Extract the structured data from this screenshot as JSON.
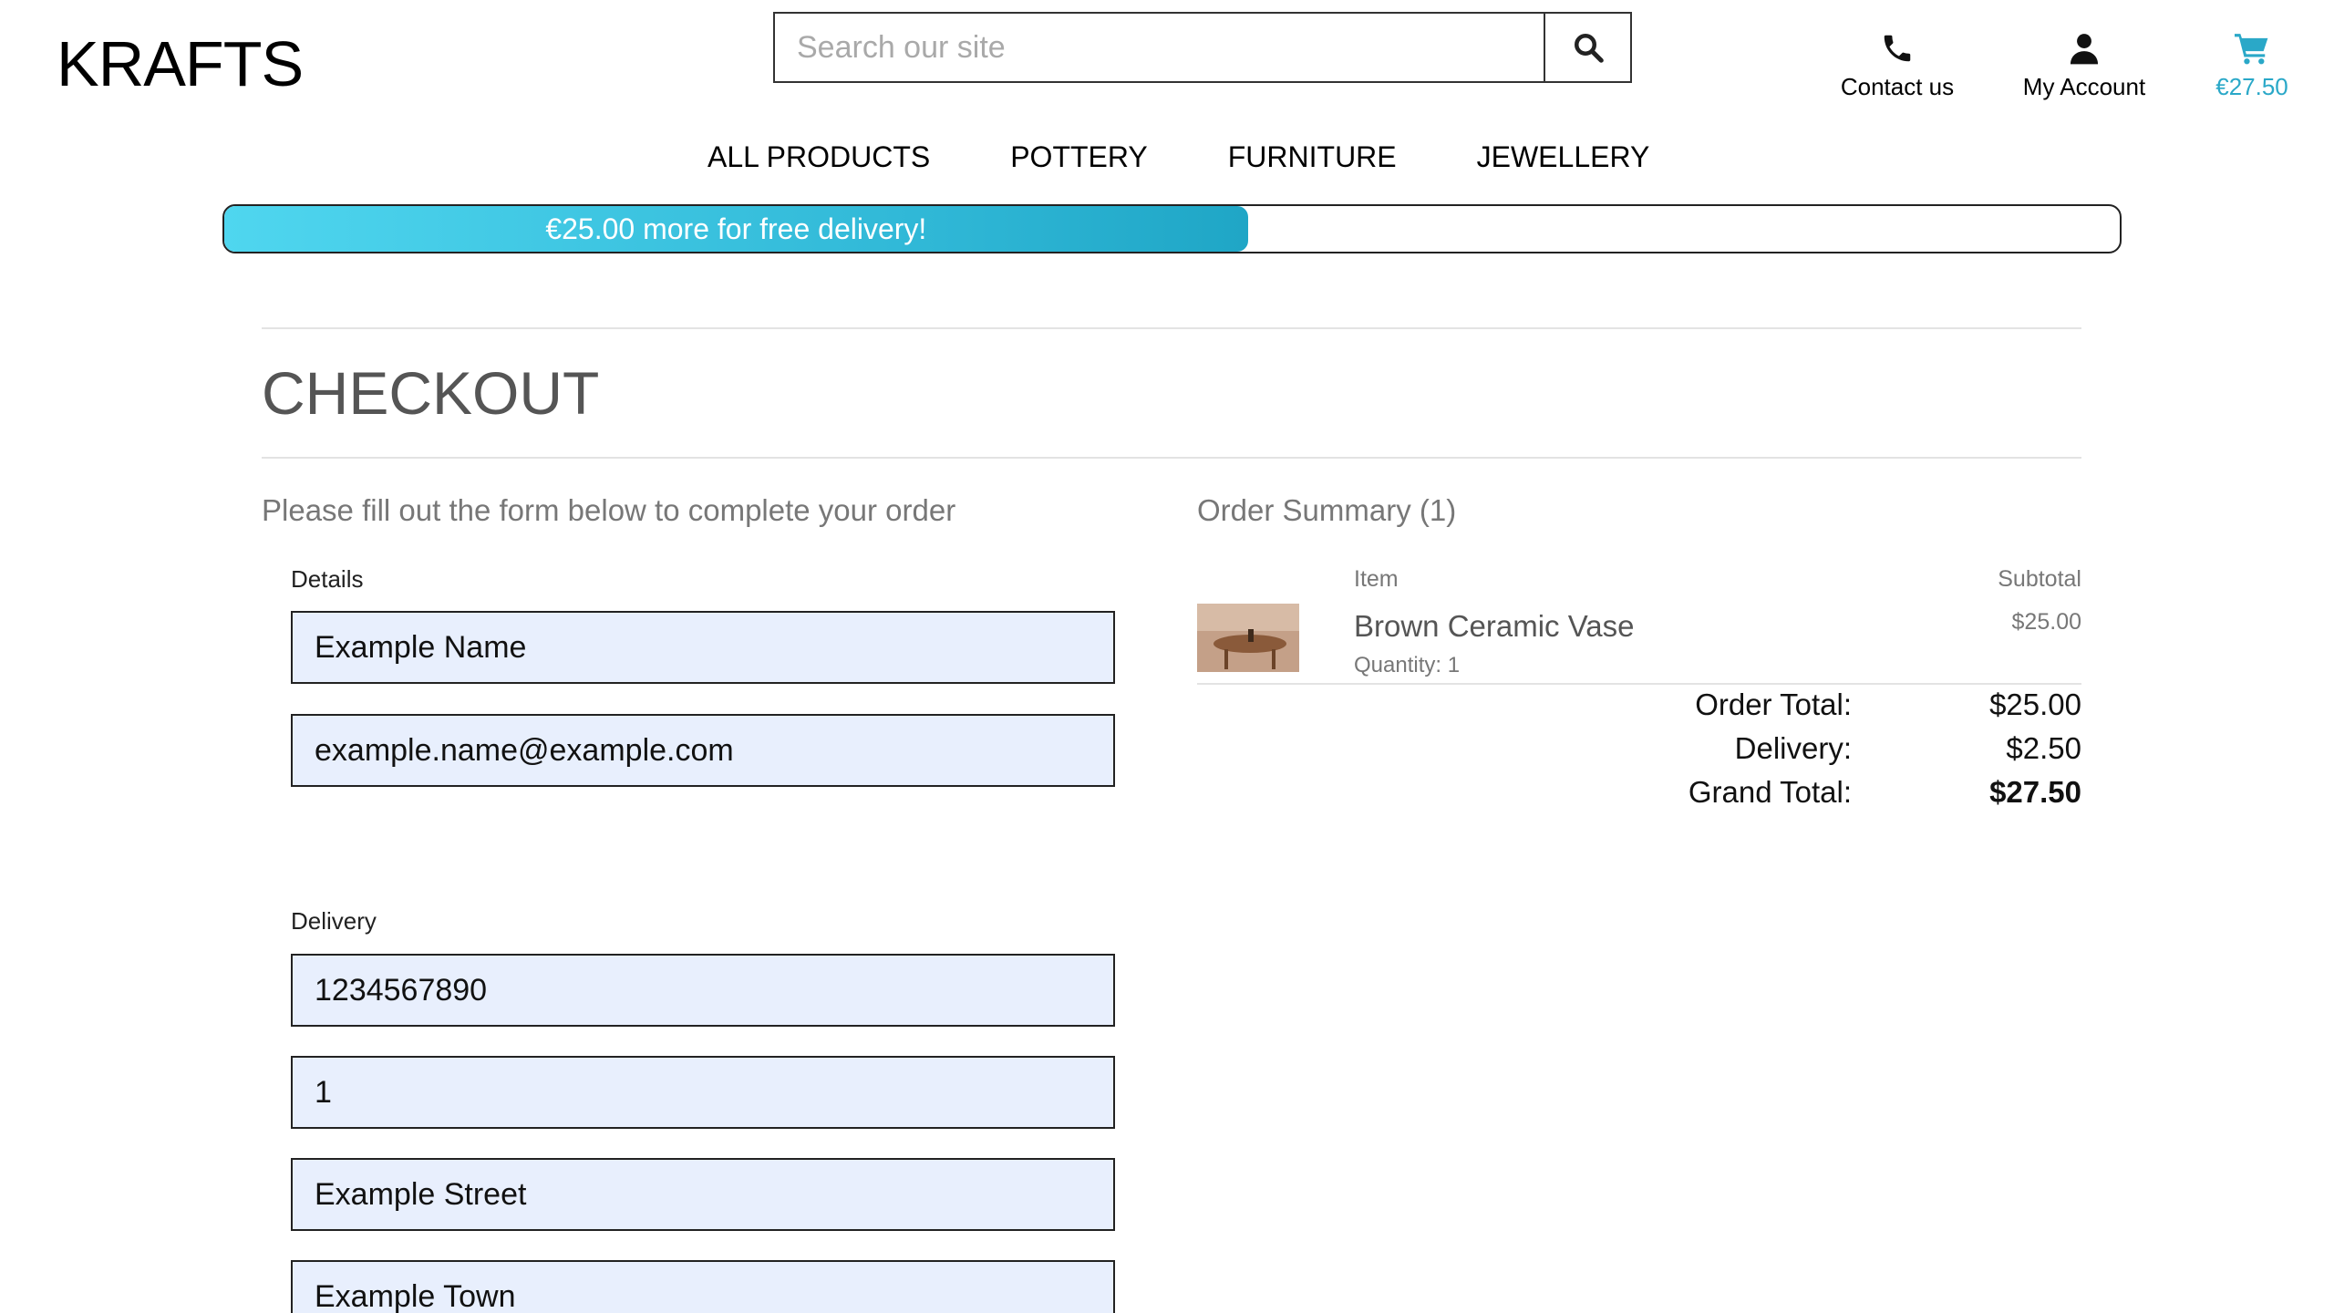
{
  "brand": {
    "logo": "KRAFTS"
  },
  "search": {
    "placeholder": "Search our site",
    "icon": "search-icon"
  },
  "header": {
    "contact": {
      "label": "Contact us",
      "icon": "phone-icon"
    },
    "account": {
      "label": "My Account",
      "icon": "user-icon"
    },
    "cart": {
      "label": "€27.50",
      "icon": "cart-icon",
      "color": "#2aa8c8"
    }
  },
  "nav": {
    "items": [
      "ALL PRODUCTS",
      "POTTERY",
      "FURNITURE",
      "JEWELLERY"
    ]
  },
  "delivery_banner": {
    "text": "€25.00 more for free delivery!",
    "progress_fraction": 0.54
  },
  "checkout": {
    "title": "CHECKOUT",
    "intro": "Please fill out the form below to complete your order",
    "details_label": "Details",
    "delivery_label": "Delivery",
    "fields": {
      "full_name": "Example Name",
      "email": "example.name@example.com",
      "phone": "1234567890",
      "street_address1": "1",
      "street_address2": "Example Street",
      "town": "Example Town"
    }
  },
  "summary": {
    "title": "Order Summary (1)",
    "item_header": "Item",
    "subtotal_header": "Subtotal",
    "item": {
      "name": "Brown Ceramic Vase",
      "quantity": "Quantity: 1",
      "subtotal": "$25.00"
    },
    "order_total_label": "Order Total:",
    "order_total": "$25.00",
    "delivery_label": "Delivery:",
    "delivery": "$2.50",
    "grand_total_label": "Grand Total:",
    "grand_total": "$27.50"
  }
}
